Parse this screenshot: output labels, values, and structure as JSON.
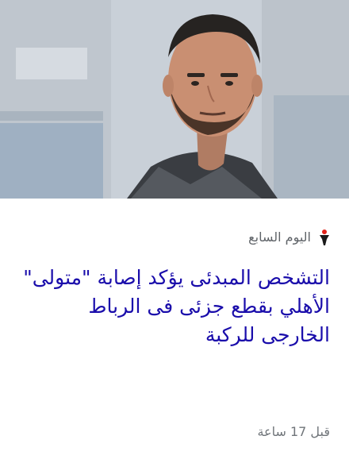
{
  "article": {
    "image_icon": "player-photo",
    "source": {
      "logo_icon": "youm7-logo-icon",
      "name": "اليوم السابع"
    },
    "headline": "التشخص المبدئى يؤكد إصابة \"متولى\" الأهلي بقطع جزئى فى الرباط الخارجى للركبة",
    "timestamp": "قبل 17 ساعة"
  },
  "colors": {
    "headline": "#1a0dab",
    "meta_text": "#70757a",
    "logo_red": "#e2231a"
  }
}
